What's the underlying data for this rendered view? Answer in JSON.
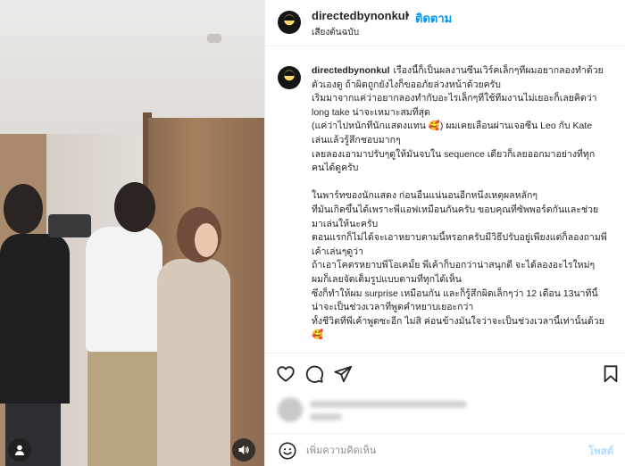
{
  "header": {
    "username": "directedbynonkul",
    "separator": "•",
    "follow_label": "ติดตาม",
    "audio_label": "เสียงต้นฉบับ"
  },
  "caption": {
    "username": "directedbynonkul",
    "lines": [
      "เรื่องนี้ก็เป็นผลงานซีนเวิร์คเล็กๆที่ผมอยากลองทำด้วย",
      "ตัวเองดู ถ้าผิดถูกยังไงก็ขออภัยล่วงหน้าด้วยครับ",
      "เริ่มมาจากแค่ว่าอยากลองทำกับอะไรเล็กๆที่ใช้ทีมงานไม่เยอะก็เลยคิดว่า",
      "long take น่าจะเหมาะสมที่สุด",
      "(แค่ว่าไปหนักที่นักแสดงแทน 🥰) ผมเคยเลื่อนผ่านเจอซีน Leo กับ Kate",
      "เล่นแล้วรู้สึกชอบมากๆ",
      "เลยลองเอามาปรับๆดูให้มันจบใน sequence เดียวก็เลยออกมาอย่างที่ทุก",
      "คนได้ดูครับ",
      "",
      "ในพาร์ทของนักแสดง ก่อนอื่นแน่นอนอีกหนึ่งเหตุผลหลักๆ",
      "ที่มันเกิดขึ้นได้เพราะพี่แอฟเหมือนกันครับ ขอบคุณที่ซัพพอร์ตกันและช่วย",
      "มาเล่นให้นะครับ",
      "ตอนแรกก็ไม่ได้จะเอาหยาบตามนี้หรอกครับมีวิธีปรับอยู่เพียงแต่ก็ลองถามพี่",
      "เค้าเล่นๆดูว่า",
      "ถ้าเอาโคตรหยาบพี่โอเคมั้ย พี่เค้าก็บอกว่าน่าสนุกดี จะได้ลองอะไรใหม่ๆ",
      "ผมก็เลยจัดเต็มรูปแบบตามที่ทุกได้เห็น",
      "ซึ่งก็ทำให้ผม surprise เหมือนกัน และก็รู้สึกผิดเล็กๆว่า 12 เดือน 13นาทีนี้",
      "น่าจะเป็นช่วงเวลาที่พูดคำหยาบเยอะกว่า",
      "ทั้งชีวิตที่พี่เค้าพูดซะอีก ไม่สิ ค่อนข้างมั่นใจว่าจะเป็นช่วงเวลานี้เท่านั้นด้วย",
      "🥰"
    ]
  },
  "actions": {
    "like_icon": "heart-icon",
    "comment_icon": "comment-icon",
    "share_icon": "share-icon",
    "save_icon": "bookmark-icon"
  },
  "comment_bar": {
    "placeholder": "เพิ่มความคิดเห็น",
    "post_label": "โพสต์"
  },
  "colors": {
    "accent": "#0095f6",
    "post_disabled": "#b3dbff",
    "text": "#262626",
    "muted": "#8e8e8e"
  }
}
